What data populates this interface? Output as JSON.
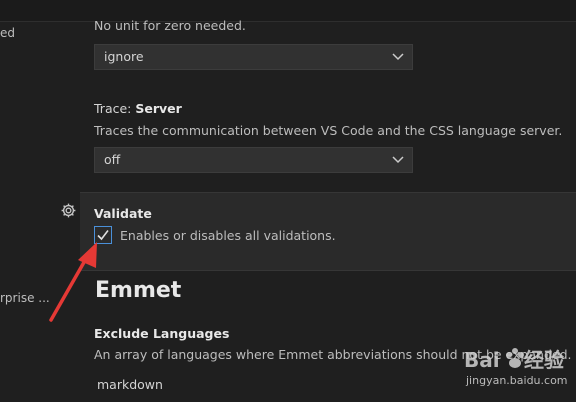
{
  "sidebar": {
    "items": [
      {
        "label": "ed"
      },
      {
        "label": "rprise ..."
      }
    ]
  },
  "settings": {
    "zero_units": {
      "description": "No unit for zero needed.",
      "value": "ignore"
    },
    "trace": {
      "title_prefix": "Trace: ",
      "title_name": "Server",
      "description": "Traces the communication between VS Code and the CSS language server.",
      "value": "off"
    },
    "validate": {
      "title": "Validate",
      "checkbox_label": "Enables or disables all validations.",
      "checked": true
    }
  },
  "emmet": {
    "section_title": "Emmet",
    "exclude_languages": {
      "title": "Exclude Languages",
      "description": "An array of languages where Emmet abbreviations should not be expanded.",
      "items": [
        "markdown"
      ]
    }
  },
  "watermark": {
    "logo": "Baidu 经验",
    "url": "jingyan.baidu.com"
  },
  "colors": {
    "background": "#1f1f1f",
    "focused_row": "#2a2a2a",
    "checkbox_border": "#4a90d9",
    "annotation_arrow": "#e53935"
  }
}
